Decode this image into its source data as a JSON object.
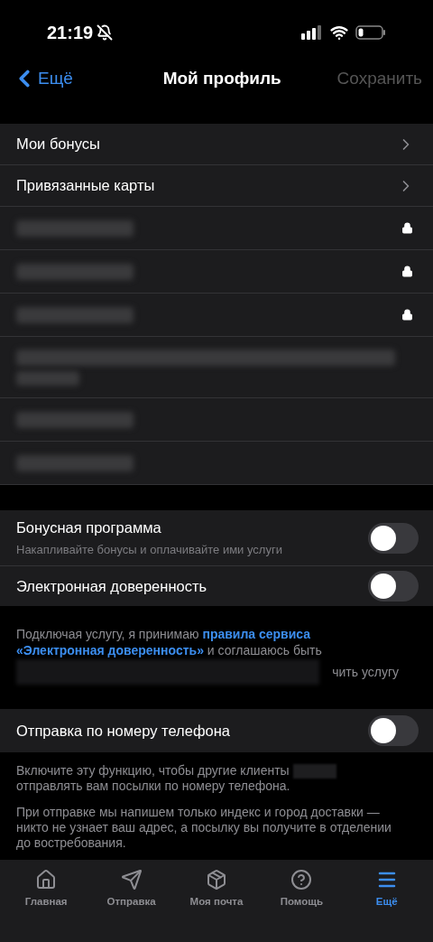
{
  "status_bar": {
    "time": "21:19"
  },
  "nav": {
    "back": "Ещё",
    "title": "Мой профиль",
    "action": "Сохранить",
    "action_disabled": true
  },
  "links": [
    {
      "label": "Мои бонусы"
    },
    {
      "label": "Привязанные карты"
    }
  ],
  "hidden_rows": [
    {
      "locked": true,
      "kind": "short"
    },
    {
      "locked": true,
      "kind": "short"
    },
    {
      "locked": true,
      "kind": "short"
    },
    {
      "locked": false,
      "kind": "long"
    },
    {
      "locked": false,
      "kind": "short"
    },
    {
      "locked": false,
      "kind": "short"
    }
  ],
  "toggles": [
    {
      "title": "Бонусная программа",
      "subtitle": "Накапливайте бонусы и оплачивайте ими услуги",
      "on": false
    },
    {
      "title": "Электронная доверенность",
      "on": false
    }
  ],
  "consent": {
    "before": "Подключая услугу, я принимаю ",
    "link_lines": [
      "правила сервиса",
      "«Электронная доверенность»"
    ],
    "after": " и соглашаюсь быть",
    "tail": "чить услугу"
  },
  "phone_toggle": {
    "title": "Отправка по номеру телефона",
    "on": false
  },
  "phone_notes": {
    "line1": "Включите эту функцию, чтобы другие клиенты",
    "line2": "отправлять вам посылки по номеру телефона.",
    "paragraph": "При отправке мы напишем только индекс и город доставки — никто не узнает ваш адрес, а посылку вы получите в отделении до востребования."
  },
  "tabs": [
    {
      "label": "Главная",
      "selected": false
    },
    {
      "label": "Отправка",
      "selected": false
    },
    {
      "label": "Моя почта",
      "selected": false
    },
    {
      "label": "Помощь",
      "selected": false
    },
    {
      "label": "Ещё",
      "selected": true
    }
  ]
}
